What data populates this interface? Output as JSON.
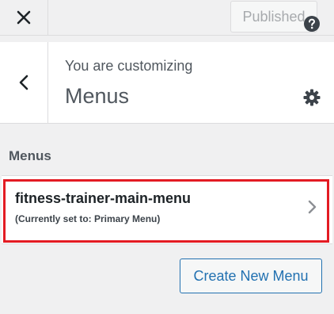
{
  "topbar": {
    "close_icon": "close-icon",
    "published_label": "Published"
  },
  "header": {
    "back_icon": "chevron-left-icon",
    "customizing_label": "You are customizing",
    "section_title": "Menus",
    "help_icon": "help-icon",
    "settings_icon": "gear-icon"
  },
  "menus": {
    "heading": "Menus",
    "items": [
      {
        "name": "fitness-trainer-main-menu",
        "location_note": "(Currently set to: Primary Menu)",
        "icon": "chevron-right-icon"
      }
    ],
    "create_button_label": "Create New Menu"
  },
  "colors": {
    "background": "#f0f0f1",
    "panel": "#ffffff",
    "accent": "#2271b1",
    "highlight": "#e31b23",
    "muted_text": "#50575e"
  }
}
